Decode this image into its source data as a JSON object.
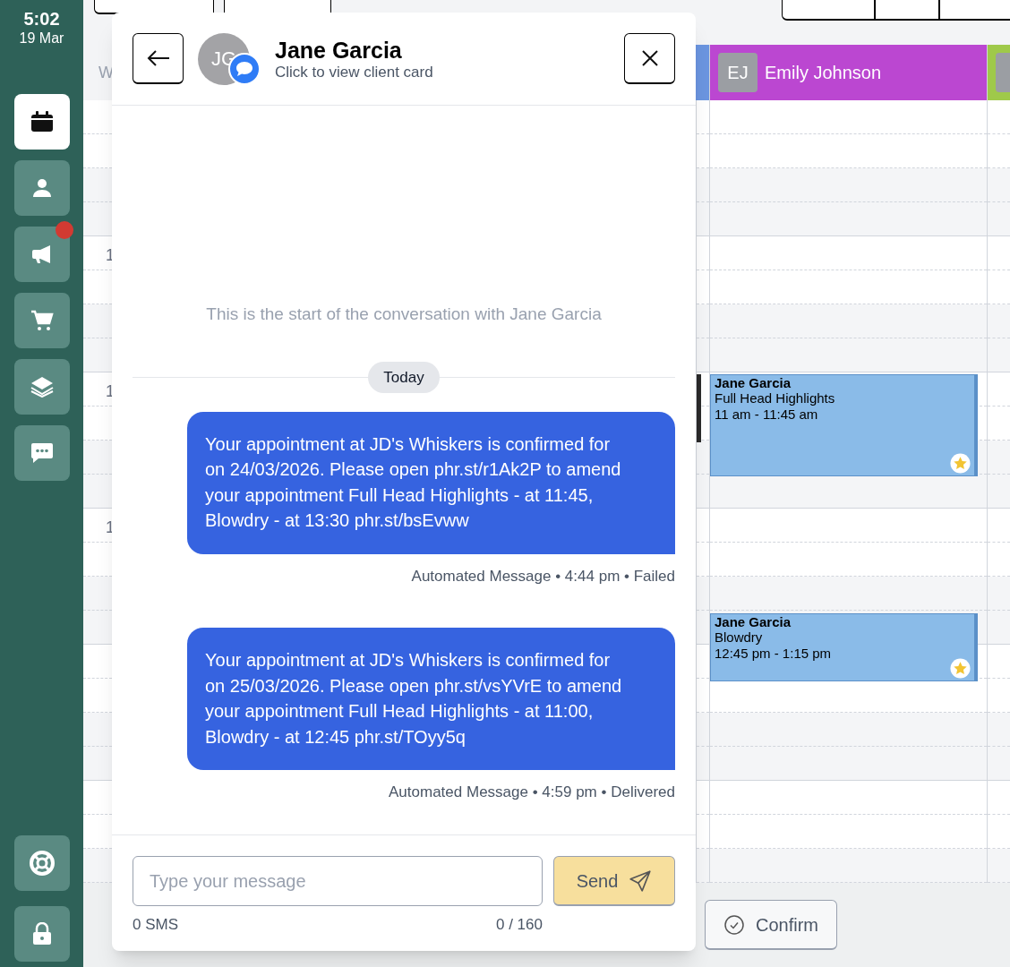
{
  "sidebar": {
    "time": "5:02",
    "date": "19 Mar",
    "items": [
      {
        "kind": "calendar",
        "selected": true,
        "badge": false
      },
      {
        "kind": "person",
        "selected": false,
        "badge": false
      },
      {
        "kind": "megaphone",
        "selected": false,
        "badge": true
      },
      {
        "kind": "cart",
        "selected": false,
        "badge": false
      },
      {
        "kind": "layers",
        "selected": false,
        "badge": false
      },
      {
        "kind": "chat",
        "selected": false,
        "badge": false
      }
    ],
    "bottom_items": [
      {
        "kind": "lifebuoy",
        "selected": false,
        "badge": false
      },
      {
        "kind": "lock",
        "selected": false,
        "badge": false
      }
    ]
  },
  "calendar": {
    "gutter_heading": "W",
    "time_labels": [
      "1",
      "1",
      "1"
    ],
    "columns": [
      {
        "color": "#6b95e0"
      },
      {
        "initials": "EJ",
        "name": "Emily Johnson",
        "color": "#bb47d1"
      },
      {
        "color": "#9fc94a"
      }
    ],
    "events": [
      {
        "client": "Jane Garcia",
        "service": "Full Head Highlights",
        "time": "11 am - 11:45 am",
        "starred": true
      },
      {
        "client": "Jane Garcia",
        "service": "Blowdry",
        "time": "12:45 pm - 1:15 pm",
        "starred": true
      }
    ],
    "confirm_button": "Confirm"
  },
  "conversation": {
    "initials": "JG",
    "name": "Jane Garcia",
    "subtitle": "Click to view client card",
    "start_note": "This is the start of the conversation with Jane Garcia",
    "day_label": "Today",
    "messages": [
      {
        "text": "Your appointment at JD's Whiskers is confirmed for on 24/03/2026. Please open phr.st/r1Ak2P to amend your appointment Full Head Highlights - at 11:45, Blowdry - at 13:30 phr.st/bsEvww",
        "meta": "Automated Message • 4:44 pm • Failed"
      },
      {
        "text": "Your appointment at JD's Whiskers is confirmed for on 25/03/2026. Please open phr.st/vsYVrE to amend your appointment Full Head Highlights - at 11:00, Blowdry - at 12:45 phr.st/TOyy5q",
        "meta": "Automated Message • 4:59 pm • Delivered"
      }
    ],
    "input": {
      "placeholder": "Type your message"
    },
    "send_button": "Send",
    "sms_count": "0 SMS",
    "char_count": "0 / 160"
  }
}
